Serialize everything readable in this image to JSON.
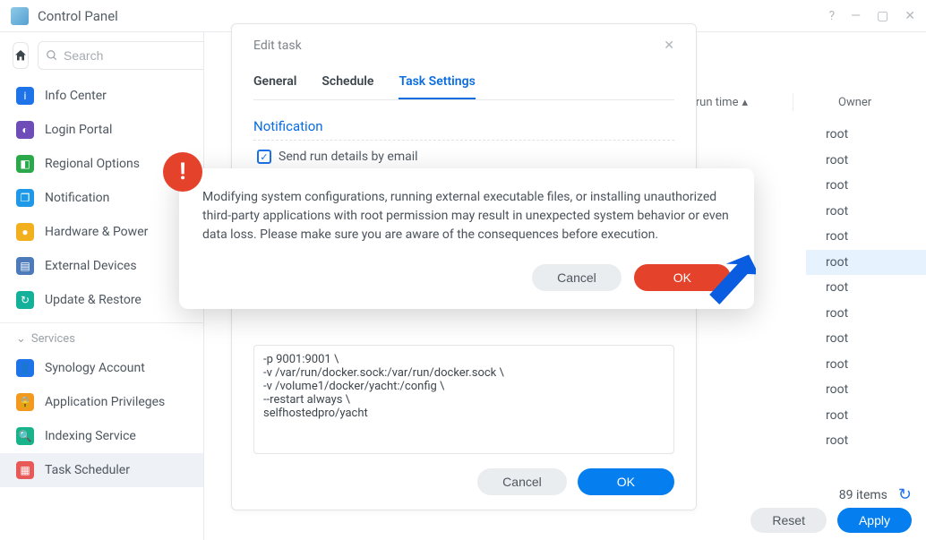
{
  "titlebar": {
    "title": "Control Panel"
  },
  "sidebar": {
    "search_placeholder": "Search",
    "items": [
      {
        "label": "Info Center",
        "color": "#1e73e8"
      },
      {
        "label": "Login Portal",
        "color": "#6f4db8"
      },
      {
        "label": "Regional Options",
        "color": "#2aa84a"
      },
      {
        "label": "Notification",
        "color": "#1e99e8"
      },
      {
        "label": "Hardware & Power",
        "color": "#f2b01e"
      },
      {
        "label": "External Devices",
        "color": "#4d7ab8"
      },
      {
        "label": "Update & Restore",
        "color": "#13b09a"
      }
    ],
    "section_label": "Services",
    "services": [
      {
        "label": "Synology Account",
        "color": "#1e73e8"
      },
      {
        "label": "Application Privileges",
        "color": "#f29a1e"
      },
      {
        "label": "Indexing Service",
        "color": "#18b38b"
      },
      {
        "label": "Task Scheduler",
        "color": "#e85a58",
        "active": true
      }
    ]
  },
  "table": {
    "col_runtime": "t run time",
    "col_owner": "Owner",
    "owners": [
      "root",
      "root",
      "root",
      "root",
      "root",
      "root",
      "root",
      "root",
      "root",
      "root",
      "root",
      "root",
      "root"
    ],
    "selected_index": 5,
    "footer_count": "89 items"
  },
  "edit_dialog": {
    "title": "Edit task",
    "tabs": {
      "general": "General",
      "schedule": "Schedule",
      "settings": "Task Settings"
    },
    "group_notification": "Notification",
    "chk_label": "Send run details by email",
    "script": "-p 9001:9001 \\\n-v /var/run/docker.sock:/var/run/docker.sock \\\n-v /volume1/docker/yacht:/config \\\n--restart always \\\nselfhostedpro/yacht",
    "cancel": "Cancel",
    "ok": "OK"
  },
  "warn_dialog": {
    "text": "Modifying system configurations, running external executable files, or installing unauthorized third-party applications with root permission may result in unexpected system behavior or even data loss. Please make sure you are aware of the consequences before execution.",
    "cancel": "Cancel",
    "ok": "OK"
  },
  "app_footer": {
    "reset": "Reset",
    "apply": "Apply"
  }
}
